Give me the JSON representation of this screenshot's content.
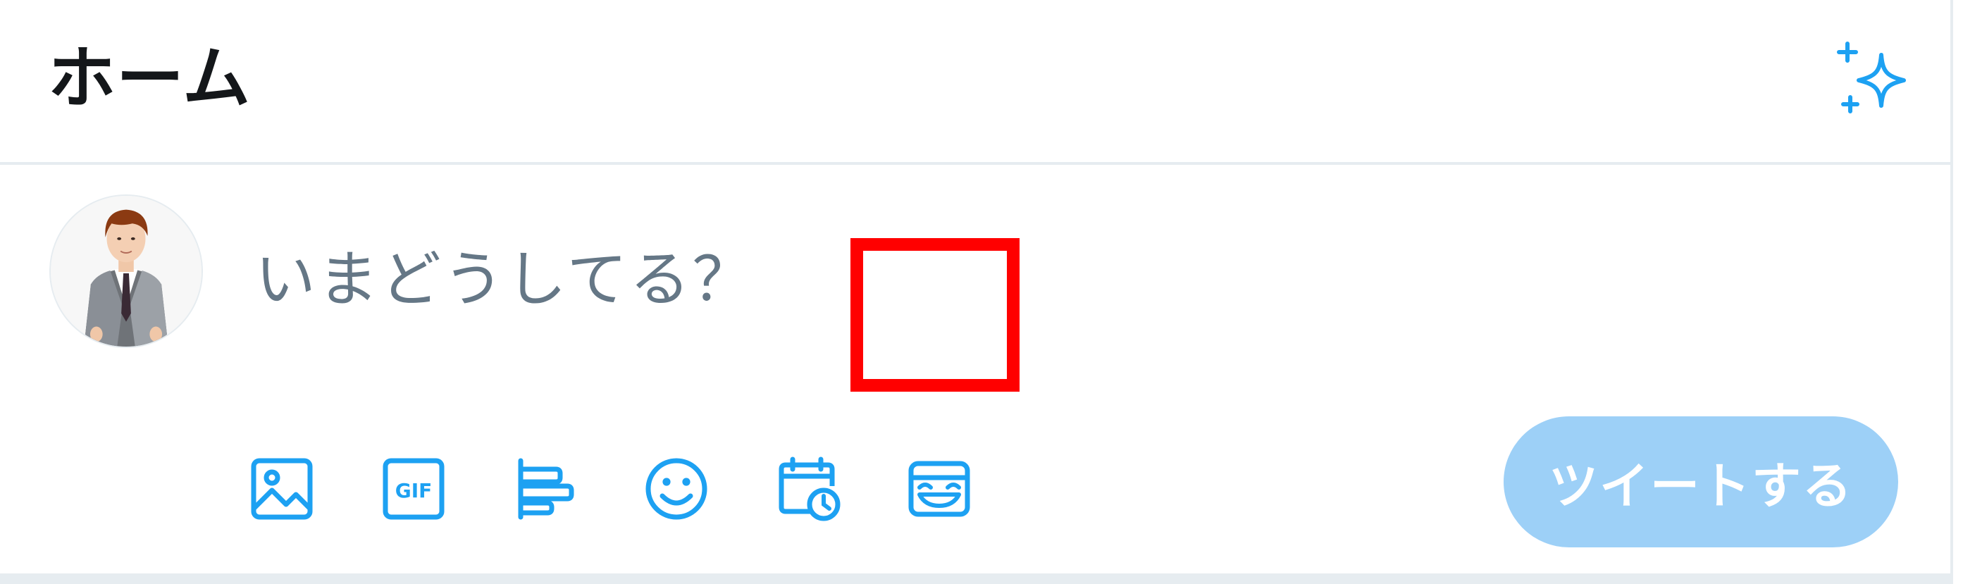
{
  "header": {
    "title": "ホーム",
    "sparkle_icon": "sparkle-icon"
  },
  "compose": {
    "placeholder": "いまどうしてる？",
    "tweet_button_label": "ツイートする",
    "toolbar": [
      {
        "name": "image-icon"
      },
      {
        "name": "gif-icon",
        "text": "GIF"
      },
      {
        "name": "poll-icon"
      },
      {
        "name": "emoji-icon"
      },
      {
        "name": "schedule-icon"
      },
      {
        "name": "stickers-icon"
      }
    ]
  },
  "colors": {
    "accent": "#1da1f2",
    "button_disabled": "#9dd0f7",
    "placeholder": "#657786",
    "highlight": "#ff0000"
  }
}
